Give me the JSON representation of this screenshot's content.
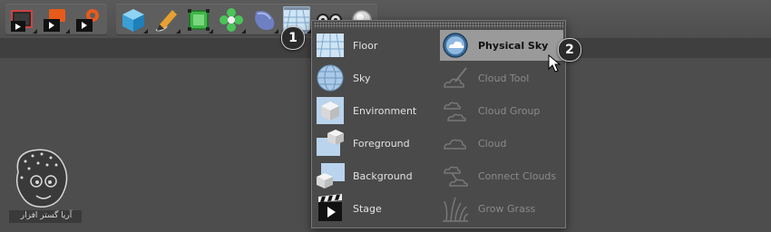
{
  "toolbar": {
    "group1": [
      "render-view-icon",
      "render-active-icon",
      "render-settings-icon"
    ],
    "group2": [
      "cube-icon",
      "pen-icon",
      "subdivision-icon",
      "cloner-icon",
      "deformer-icon",
      "floor-icon",
      "camera-icon",
      "light-icon"
    ]
  },
  "dropdown": {
    "left_items": [
      {
        "label": "Floor",
        "icon": "floor-icon"
      },
      {
        "label": "Sky",
        "icon": "sky-icon"
      },
      {
        "label": "Environment",
        "icon": "environment-icon"
      },
      {
        "label": "Foreground",
        "icon": "foreground-icon"
      },
      {
        "label": "Background",
        "icon": "background-icon"
      },
      {
        "label": "Stage",
        "icon": "stage-icon"
      }
    ],
    "right_items": [
      {
        "label": "Physical Sky",
        "icon": "physical-sky-icon",
        "state": "hover"
      },
      {
        "label": "Cloud Tool",
        "icon": "cloud-tool-icon",
        "state": "disabled"
      },
      {
        "label": "Cloud Group",
        "icon": "cloud-group-icon",
        "state": "disabled"
      },
      {
        "label": "Cloud",
        "icon": "cloud-icon",
        "state": "disabled"
      },
      {
        "label": "Connect Clouds",
        "icon": "connect-clouds-icon",
        "state": "disabled"
      },
      {
        "label": "Grow Grass",
        "icon": "grow-grass-icon",
        "state": "disabled"
      }
    ]
  },
  "callouts": {
    "one": "1",
    "two": "2"
  },
  "watermark": {
    "text": "آریا گستر افزار"
  },
  "colors": {
    "hover": "#9a9a9a",
    "active": "#7d8fa4",
    "panel": "#4a4a4a"
  }
}
